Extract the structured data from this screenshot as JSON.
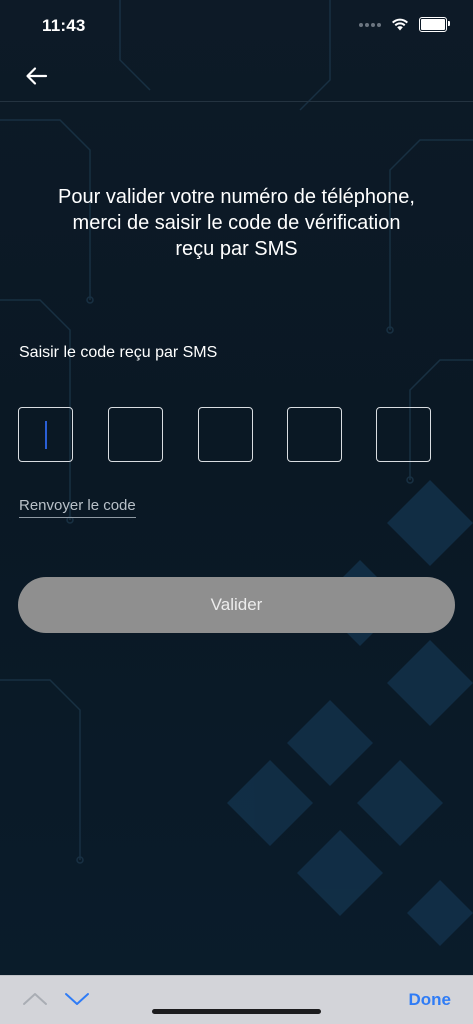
{
  "status_bar": {
    "time": "11:43",
    "icons": [
      "signal-dots-icon",
      "wifi-icon",
      "battery-icon"
    ],
    "battery_level": 1.0
  },
  "nav": {
    "back_icon": "arrow-left-icon"
  },
  "content": {
    "title": "Pour valider votre numéro de téléphone,\nmerci de saisir le code de vérification\nreçu par SMS",
    "code_label": "Saisir le code reçu par SMS",
    "code_boxes": [
      "",
      "",
      "",
      "",
      ""
    ],
    "resend_label": "Renvoyer le code",
    "validate_label": "Valider"
  },
  "keyboard_toolbar": {
    "up_icon": "chevron-up-icon",
    "down_icon": "chevron-down-icon",
    "done_label": "Done"
  },
  "colors": {
    "background": "#0b1520",
    "button_disabled": "#8f8f8f",
    "link_accent": "#2f7cf6",
    "cursor": "#2a5fd6"
  }
}
